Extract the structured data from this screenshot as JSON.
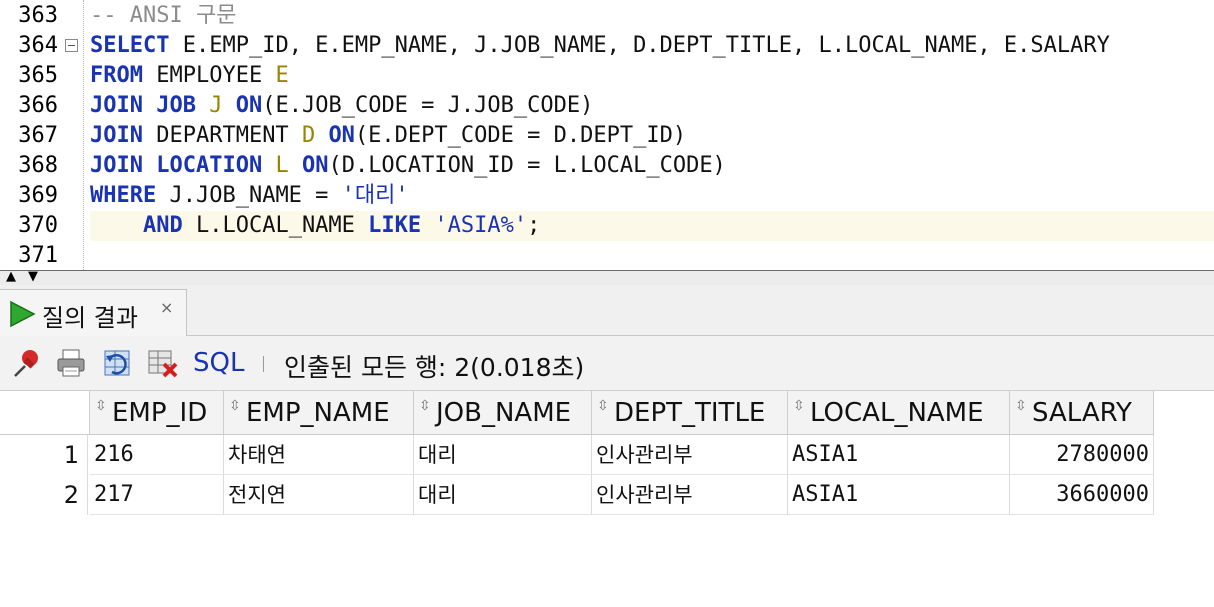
{
  "editor": {
    "lines": [
      {
        "num": "363",
        "fold": false,
        "current": false,
        "tokens": [
          {
            "t": "-- ANSI 구문",
            "c": "cmt"
          }
        ]
      },
      {
        "num": "364",
        "fold": true,
        "current": false,
        "tokens": [
          {
            "t": "SELECT",
            "c": "kw"
          },
          {
            "t": " E.EMP_ID, E.EMP_NAME, J.JOB_NAME, D.DEPT_TITLE, L.LOCAL_NAME, E.SALARY",
            "c": "plain"
          }
        ]
      },
      {
        "num": "365",
        "fold": false,
        "current": false,
        "tokens": [
          {
            "t": "FROM",
            "c": "kw"
          },
          {
            "t": " EMPLOYEE ",
            "c": "plain"
          },
          {
            "t": "E",
            "c": "al"
          }
        ]
      },
      {
        "num": "366",
        "fold": false,
        "current": false,
        "tokens": [
          {
            "t": "JOIN",
            "c": "kw"
          },
          {
            "t": " ",
            "c": "plain"
          },
          {
            "t": "JOB",
            "c": "kw"
          },
          {
            "t": " ",
            "c": "plain"
          },
          {
            "t": "J",
            "c": "al"
          },
          {
            "t": " ",
            "c": "plain"
          },
          {
            "t": "ON",
            "c": "kw"
          },
          {
            "t": "(E.JOB_CODE = J.JOB_CODE)",
            "c": "plain"
          }
        ]
      },
      {
        "num": "367",
        "fold": false,
        "current": false,
        "tokens": [
          {
            "t": "JOIN",
            "c": "kw"
          },
          {
            "t": " DEPARTMENT ",
            "c": "plain"
          },
          {
            "t": "D",
            "c": "al"
          },
          {
            "t": " ",
            "c": "plain"
          },
          {
            "t": "ON",
            "c": "kw"
          },
          {
            "t": "(E.DEPT_CODE = D.DEPT_ID)",
            "c": "plain"
          }
        ]
      },
      {
        "num": "368",
        "fold": false,
        "current": false,
        "tokens": [
          {
            "t": "JOIN",
            "c": "kw"
          },
          {
            "t": " ",
            "c": "plain"
          },
          {
            "t": "LOCATION",
            "c": "kw"
          },
          {
            "t": " ",
            "c": "plain"
          },
          {
            "t": "L",
            "c": "al"
          },
          {
            "t": " ",
            "c": "plain"
          },
          {
            "t": "ON",
            "c": "kw"
          },
          {
            "t": "(D.LOCATION_ID = L.LOCAL_CODE)",
            "c": "plain"
          }
        ]
      },
      {
        "num": "369",
        "fold": false,
        "current": false,
        "tokens": [
          {
            "t": "WHERE",
            "c": "kw"
          },
          {
            "t": " J.JOB_NAME = ",
            "c": "plain"
          },
          {
            "t": "'대리'",
            "c": "str"
          }
        ]
      },
      {
        "num": "370",
        "fold": false,
        "current": true,
        "tokens": [
          {
            "t": "    ",
            "c": "plain"
          },
          {
            "t": "AND",
            "c": "kw"
          },
          {
            "t": " L.LOCAL_NAME ",
            "c": "plain"
          },
          {
            "t": "LIKE",
            "c": "kw"
          },
          {
            "t": " ",
            "c": "plain"
          },
          {
            "t": "'ASIA%'",
            "c": "str"
          },
          {
            "t": ";",
            "c": "plain"
          }
        ]
      },
      {
        "num": "371",
        "fold": false,
        "current": false,
        "tokens": []
      }
    ]
  },
  "results_tab": {
    "label": "질의 결과",
    "close": "×"
  },
  "toolbar": {
    "icons": [
      "pin-icon",
      "print-icon",
      "refresh-icon",
      "cancel-query-icon"
    ],
    "sql_label": "SQL",
    "status": "인출된 모든 행: 2(0.018초)"
  },
  "grid": {
    "columns": [
      "EMP_ID",
      "EMP_NAME",
      "JOB_NAME",
      "DEPT_TITLE",
      "LOCAL_NAME",
      "SALARY"
    ],
    "rows": [
      {
        "n": "1",
        "cells": [
          "216",
          "차태연",
          "대리",
          "인사관리부",
          "ASIA1",
          "2780000"
        ]
      },
      {
        "n": "2",
        "cells": [
          "217",
          "전지연",
          "대리",
          "인사관리부",
          "ASIA1",
          "3660000"
        ]
      }
    ]
  },
  "colors": {
    "keyword": "#1a33b3",
    "alias": "#9a8500",
    "comment": "#8c8c8c",
    "current_line": "#fdf9e8"
  }
}
